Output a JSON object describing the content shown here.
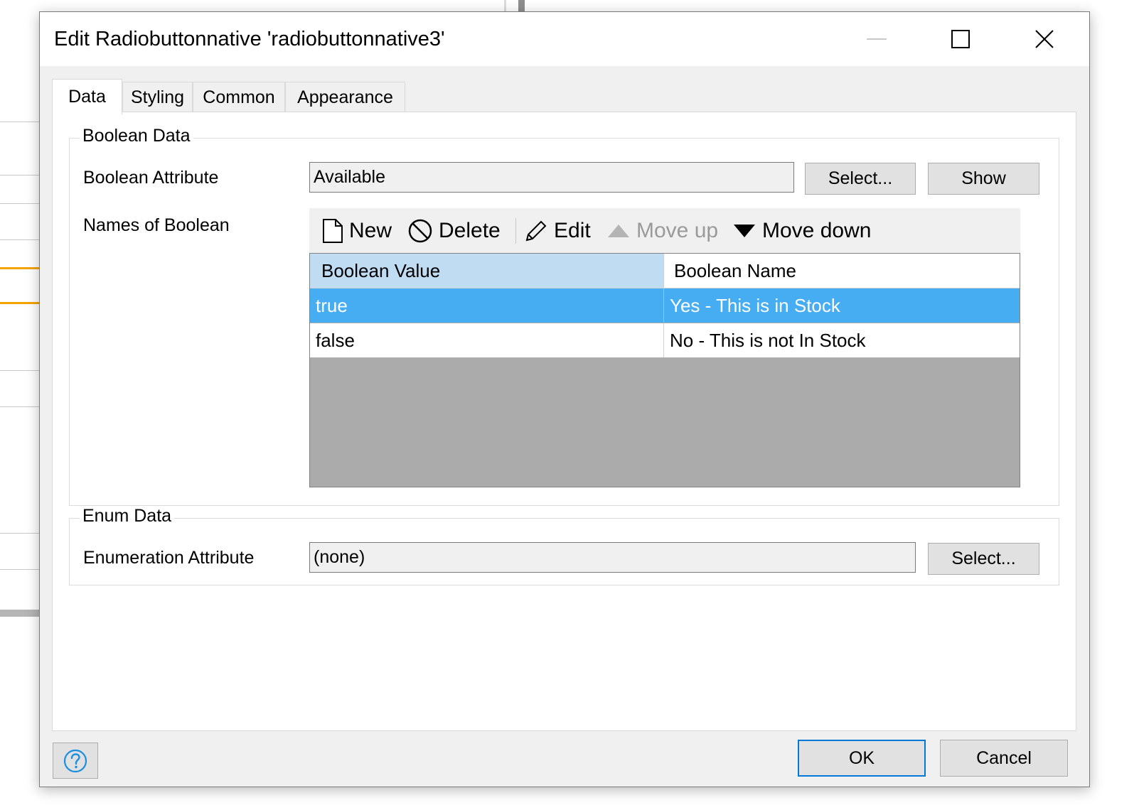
{
  "window": {
    "title": "Edit Radiobuttonnative 'radiobuttonnative3'"
  },
  "tabs": [
    {
      "label": "Data",
      "active": true
    },
    {
      "label": "Styling",
      "active": false
    },
    {
      "label": "Common",
      "active": false
    },
    {
      "label": "Appearance",
      "active": false
    }
  ],
  "boolean_data": {
    "legend": "Boolean Data",
    "attribute_label": "Boolean Attribute",
    "attribute_value": "Available",
    "select_label": "Select...",
    "show_label": "Show",
    "names_label": "Names of Boolean",
    "toolbar": {
      "new": "New",
      "delete": "Delete",
      "edit": "Edit",
      "move_up": "Move up",
      "move_down": "Move down"
    },
    "table": {
      "headers": [
        "Boolean Value",
        "Boolean Name"
      ],
      "rows": [
        {
          "value": "true",
          "name": "Yes - This is in Stock",
          "selected": true
        },
        {
          "value": "false",
          "name": "No - This is not In Stock",
          "selected": false
        }
      ]
    }
  },
  "enum_data": {
    "legend": "Enum Data",
    "attribute_label": "Enumeration Attribute",
    "attribute_value": "(none)",
    "select_label": "Select..."
  },
  "footer": {
    "ok_label": "OK",
    "cancel_label": "Cancel"
  },
  "colors": {
    "selection": "#46adf3",
    "header_highlight": "#bfdcf3",
    "accent": "#0078d7"
  }
}
